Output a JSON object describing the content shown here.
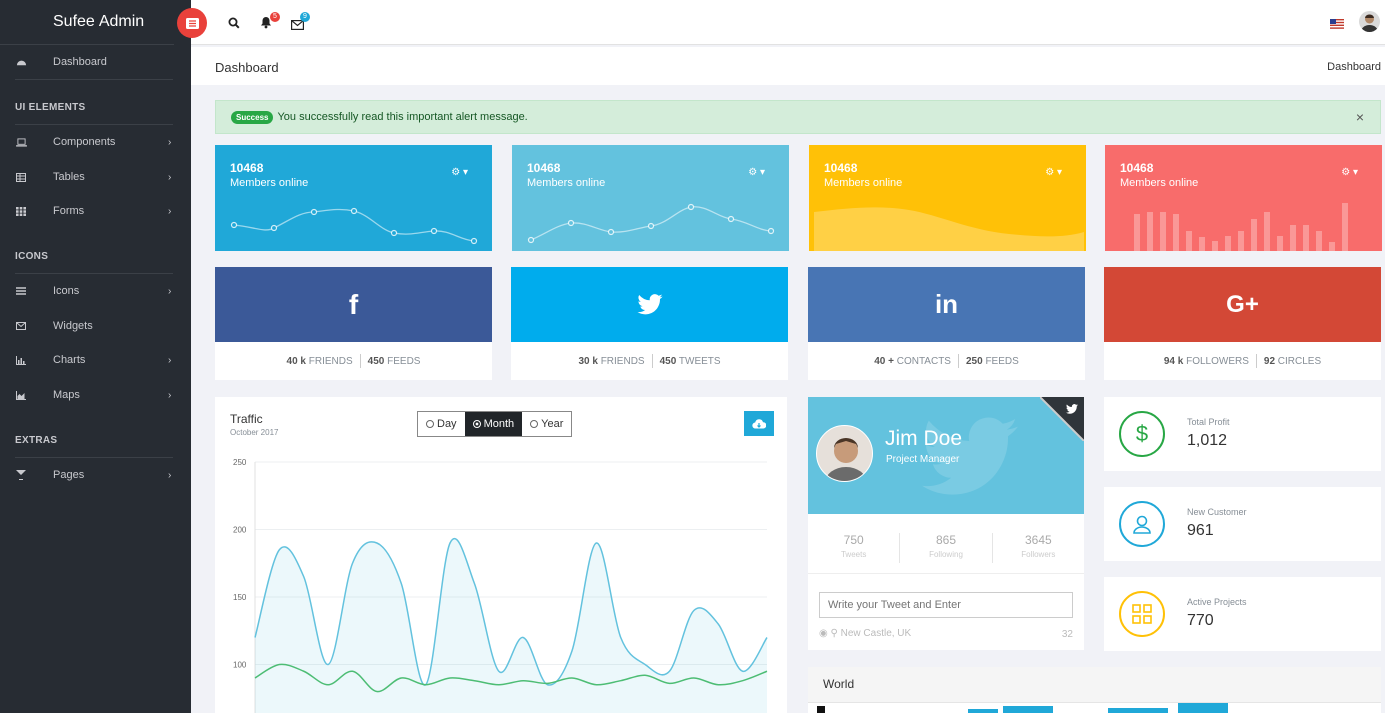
{
  "brand": {
    "part1": "Sufee",
    "part2": "Admin"
  },
  "nav": {
    "dashboard": "Dashboard",
    "sec_ui": "UI ELEMENTS",
    "components": "Components",
    "tables": "Tables",
    "forms": "Forms",
    "sec_icons": "ICONS",
    "icons": "Icons",
    "widgets": "Widgets",
    "charts": "Charts",
    "maps": "Maps",
    "sec_extras": "EXTRAS",
    "pages": "Pages"
  },
  "topbar": {
    "notif_count": "5",
    "mail_count": "9"
  },
  "page": {
    "title": "Dashboard",
    "breadcrumb": "Dashboard"
  },
  "alert": {
    "badge": "Success",
    "message": "You successfully read this important alert message.",
    "close": "×"
  },
  "stats": [
    {
      "value": "10468",
      "caption": "Members online",
      "color": "#20a8d8"
    },
    {
      "value": "10468",
      "caption": "Members online",
      "color": "#63c2de"
    },
    {
      "value": "10468",
      "caption": "Members online",
      "color": "#ffc107"
    },
    {
      "value": "10468",
      "caption": "Members online",
      "color": "#f86c6b"
    }
  ],
  "social": [
    {
      "network": "facebook",
      "icon": "f",
      "color": "#3b5998",
      "a_num": "40 k",
      "a_lbl": "FRIENDS",
      "b_num": "450",
      "b_lbl": "FEEDS"
    },
    {
      "network": "twitter",
      "icon": "twitter-bird",
      "color": "#00aced",
      "a_num": "30 k",
      "a_lbl": "FRIENDS",
      "b_num": "450",
      "b_lbl": "TWEETS"
    },
    {
      "network": "linkedin",
      "icon": "in",
      "color": "#4875b4",
      "a_num": "40 +",
      "a_lbl": "CONTACTS",
      "b_num": "250",
      "b_lbl": "FEEDS"
    },
    {
      "network": "google-plus",
      "icon": "G+",
      "color": "#d34836",
      "a_num": "94 k",
      "a_lbl": "FOLLOWERS",
      "b_num": "92",
      "b_lbl": "CIRCLES"
    }
  ],
  "traffic": {
    "title": "Traffic",
    "subtitle": "October 2017",
    "periods": [
      "Day",
      "Month",
      "Year"
    ],
    "selected": "Month"
  },
  "chart_data": {
    "type": "line",
    "y_ticks": [
      "250",
      "200",
      "150",
      "100"
    ],
    "ylim": [
      60,
      250
    ],
    "series": [
      {
        "values": [
          120,
          185,
          165,
          100,
          175,
          190,
          160,
          85,
          190,
          160,
          95,
          120,
          85,
          110,
          190,
          120,
          100,
          95,
          140,
          130,
          95,
          120
        ]
      },
      {
        "values": [
          90,
          100,
          95,
          85,
          95,
          80,
          90,
          85,
          90,
          88,
          85,
          88,
          86,
          90,
          85,
          88,
          92,
          86,
          90,
          85,
          88,
          95
        ]
      }
    ]
  },
  "profile": {
    "name": "Jim Doe",
    "role": "Project Manager",
    "stats": [
      {
        "value": "750",
        "label": "Tweets"
      },
      {
        "value": "865",
        "label": "Following"
      },
      {
        "value": "3645",
        "label": "Followers"
      }
    ],
    "tweet_placeholder": "Write your Tweet and Enter",
    "location": "New Castle, UK",
    "count": "32"
  },
  "info": [
    {
      "title": "Total Profit",
      "value": "1,012",
      "color": "#28a745",
      "icon": "dollar-icon"
    },
    {
      "title": "New Customer",
      "value": "961",
      "color": "#20a8d8",
      "icon": "user-icon"
    },
    {
      "title": "Active Projects",
      "value": "770",
      "color": "#ffc107",
      "icon": "grid-icon"
    }
  ],
  "world": {
    "title": "World"
  }
}
